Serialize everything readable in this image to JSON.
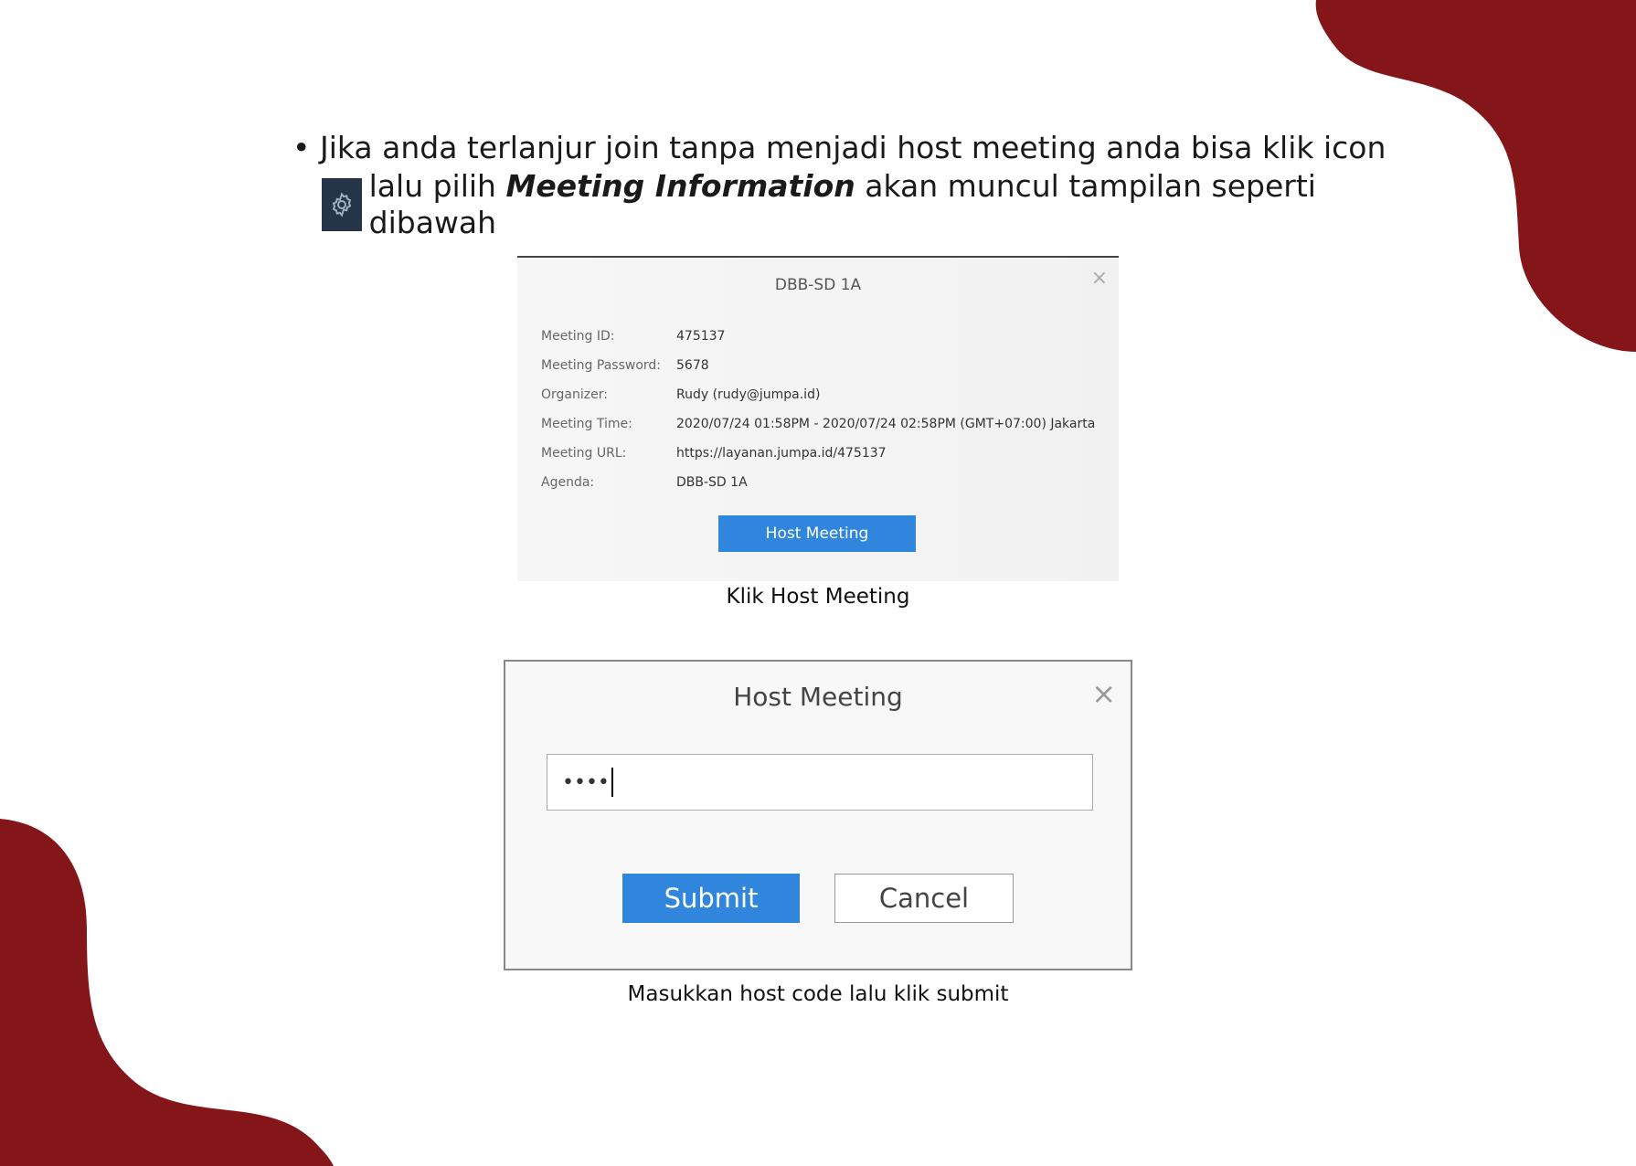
{
  "colors": {
    "accent_shape": "#84161a",
    "button_blue": "#2f86dc",
    "icon_bg": "#253548"
  },
  "instruction": {
    "bullet": "•",
    "line1": "Jika anda terlanjur join tanpa menjadi host meeting anda bisa klik icon",
    "line2_prefix": "lalu pilih",
    "line2_bold": "Meeting Information",
    "line2_suffix": "akan muncul tampilan seperti dibawah",
    "icon": "gear-icon"
  },
  "meeting_info": {
    "title": "DBB-SD 1A",
    "close_glyph": "×",
    "rows": [
      {
        "label": "Meeting ID:",
        "value": "475137"
      },
      {
        "label": "Meeting Password:",
        "value": "5678"
      },
      {
        "label": "Organizer:",
        "value": "Rudy (rudy@jumpa.id)"
      },
      {
        "label": "Meeting Time:",
        "value": "2020/07/24 01:58PM - 2020/07/24 02:58PM (GMT+07:00) Jakarta"
      },
      {
        "label": "Meeting URL:",
        "value": "https://layanan.jumpa.id/475137"
      },
      {
        "label": "Agenda:",
        "value": "DBB-SD 1A"
      }
    ],
    "button": "Host Meeting",
    "caption": "Klik Host Meeting"
  },
  "host_meeting": {
    "title": "Host Meeting",
    "close_glyph": "×",
    "input_value": "••••",
    "submit": "Submit",
    "cancel": "Cancel",
    "caption": "Masukkan host code lalu klik submit"
  }
}
